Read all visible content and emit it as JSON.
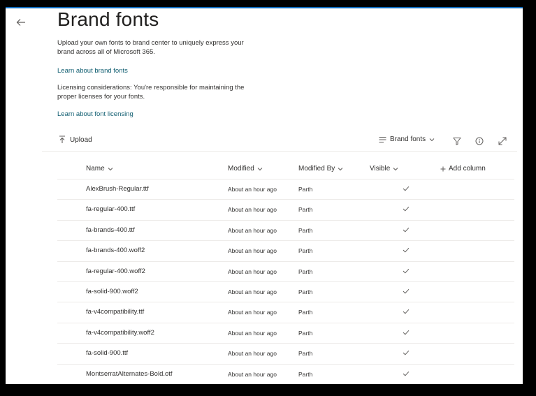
{
  "page": {
    "title": "Brand fonts",
    "description": "Upload your own fonts to brand center to uniquely express your brand across all of Microsoft 365.",
    "learn_link": "Learn about brand fonts",
    "licensing_text": "Licensing considerations: You're responsible for maintaining the proper licenses for your fonts.",
    "licensing_link": "Learn about font licensing"
  },
  "toolbar": {
    "upload_label": "Upload",
    "view_label": "Brand fonts"
  },
  "table": {
    "columns": {
      "name": "Name",
      "modified": "Modified",
      "modified_by": "Modified By",
      "visible": "Visible",
      "add_column": "Add column"
    },
    "rows": [
      {
        "name": "AlexBrush-Regular.ttf",
        "modified": "About an hour ago",
        "modified_by": "Parth",
        "visible": true
      },
      {
        "name": "fa-regular-400.ttf",
        "modified": "About an hour ago",
        "modified_by": "Parth",
        "visible": true
      },
      {
        "name": "fa-brands-400.ttf",
        "modified": "About an hour ago",
        "modified_by": "Parth",
        "visible": true
      },
      {
        "name": "fa-brands-400.woff2",
        "modified": "About an hour ago",
        "modified_by": "Parth",
        "visible": true
      },
      {
        "name": "fa-regular-400.woff2",
        "modified": "About an hour ago",
        "modified_by": "Parth",
        "visible": true
      },
      {
        "name": "fa-solid-900.woff2",
        "modified": "About an hour ago",
        "modified_by": "Parth",
        "visible": true
      },
      {
        "name": "fa-v4compatibility.ttf",
        "modified": "About an hour ago",
        "modified_by": "Parth",
        "visible": true
      },
      {
        "name": "fa-v4compatibility.woff2",
        "modified": "About an hour ago",
        "modified_by": "Parth",
        "visible": true
      },
      {
        "name": "fa-solid-900.ttf",
        "modified": "About an hour ago",
        "modified_by": "Parth",
        "visible": true
      },
      {
        "name": "MontserratAlternates-Bold.otf",
        "modified": "About an hour ago",
        "modified_by": "Parth",
        "visible": true
      }
    ]
  },
  "colors": {
    "accent": "#0f6cbd",
    "link": "#0f5d70",
    "text": "#323130",
    "divider": "#edebe9"
  },
  "icons": {
    "back": "arrow-left-icon",
    "upload": "upload-icon",
    "view": "list-view-icon",
    "filter": "filter-icon",
    "info": "info-icon",
    "expand": "expand-icon",
    "check": "checkmark-icon"
  }
}
